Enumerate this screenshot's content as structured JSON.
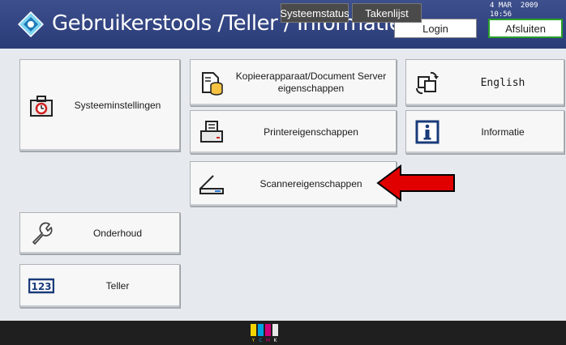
{
  "header": {
    "title": "Gebruikerstools /Teller / Informatie",
    "login_label": "Login",
    "exit_label": "Afsluiten"
  },
  "buttons": {
    "system_settings": {
      "label": "Systeeminstellingen",
      "icon": "toolbox-icon"
    },
    "copier_docserver": {
      "label_line1": "Kopieerapparaat/Document Server",
      "label_line2": "eigenschappen",
      "icon": "copier-icon"
    },
    "english": {
      "label": "English",
      "icon": "language-switch-icon"
    },
    "printer": {
      "label": "Printereigenschappen",
      "icon": "printer-icon"
    },
    "information": {
      "label": "Informatie",
      "icon": "info-icon"
    },
    "scanner": {
      "label": "Scannereigenschappen",
      "icon": "scanner-icon"
    },
    "maintenance": {
      "label": "Onderhoud",
      "icon": "wrench-icon"
    },
    "counter": {
      "label": "Teller",
      "icon": "counter-123-icon"
    }
  },
  "annotation": {
    "arrow_color": "#e00000"
  },
  "statusbar": {
    "ink_letters": [
      "Y",
      "C",
      "M",
      "K"
    ],
    "system_status_label": "Systeemstatus",
    "job_list_label": "Takenlijst",
    "date": "4 MAR  2009",
    "time": "10:56"
  },
  "colors": {
    "title_bar": "#2f4080",
    "exit_border": "#2aa02a"
  }
}
